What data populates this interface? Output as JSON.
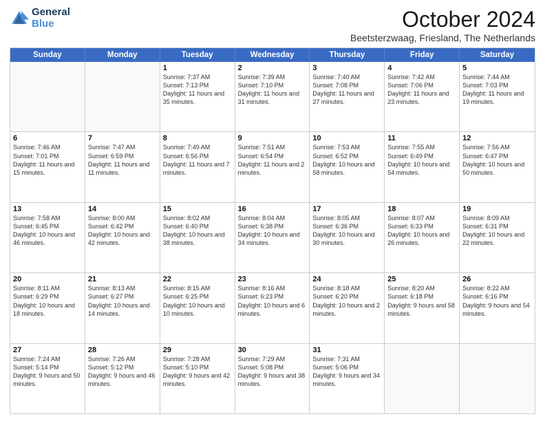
{
  "header": {
    "logo_line1": "General",
    "logo_line2": "Blue",
    "month": "October 2024",
    "location": "Beetsterzwaag, Friesland, The Netherlands"
  },
  "days_of_week": [
    "Sunday",
    "Monday",
    "Tuesday",
    "Wednesday",
    "Thursday",
    "Friday",
    "Saturday"
  ],
  "weeks": [
    [
      {
        "day": "",
        "sunrise": "",
        "sunset": "",
        "daylight": ""
      },
      {
        "day": "",
        "sunrise": "",
        "sunset": "",
        "daylight": ""
      },
      {
        "day": "1",
        "sunrise": "Sunrise: 7:37 AM",
        "sunset": "Sunset: 7:13 PM",
        "daylight": "Daylight: 11 hours and 35 minutes."
      },
      {
        "day": "2",
        "sunrise": "Sunrise: 7:39 AM",
        "sunset": "Sunset: 7:10 PM",
        "daylight": "Daylight: 11 hours and 31 minutes."
      },
      {
        "day": "3",
        "sunrise": "Sunrise: 7:40 AM",
        "sunset": "Sunset: 7:08 PM",
        "daylight": "Daylight: 11 hours and 27 minutes."
      },
      {
        "day": "4",
        "sunrise": "Sunrise: 7:42 AM",
        "sunset": "Sunset: 7:06 PM",
        "daylight": "Daylight: 11 hours and 23 minutes."
      },
      {
        "day": "5",
        "sunrise": "Sunrise: 7:44 AM",
        "sunset": "Sunset: 7:03 PM",
        "daylight": "Daylight: 11 hours and 19 minutes."
      }
    ],
    [
      {
        "day": "6",
        "sunrise": "Sunrise: 7:46 AM",
        "sunset": "Sunset: 7:01 PM",
        "daylight": "Daylight: 11 hours and 15 minutes."
      },
      {
        "day": "7",
        "sunrise": "Sunrise: 7:47 AM",
        "sunset": "Sunset: 6:59 PM",
        "daylight": "Daylight: 11 hours and 11 minutes."
      },
      {
        "day": "8",
        "sunrise": "Sunrise: 7:49 AM",
        "sunset": "Sunset: 6:56 PM",
        "daylight": "Daylight: 11 hours and 7 minutes."
      },
      {
        "day": "9",
        "sunrise": "Sunrise: 7:51 AM",
        "sunset": "Sunset: 6:54 PM",
        "daylight": "Daylight: 11 hours and 2 minutes."
      },
      {
        "day": "10",
        "sunrise": "Sunrise: 7:53 AM",
        "sunset": "Sunset: 6:52 PM",
        "daylight": "Daylight: 10 hours and 58 minutes."
      },
      {
        "day": "11",
        "sunrise": "Sunrise: 7:55 AM",
        "sunset": "Sunset: 6:49 PM",
        "daylight": "Daylight: 10 hours and 54 minutes."
      },
      {
        "day": "12",
        "sunrise": "Sunrise: 7:56 AM",
        "sunset": "Sunset: 6:47 PM",
        "daylight": "Daylight: 10 hours and 50 minutes."
      }
    ],
    [
      {
        "day": "13",
        "sunrise": "Sunrise: 7:58 AM",
        "sunset": "Sunset: 6:45 PM",
        "daylight": "Daylight: 10 hours and 46 minutes."
      },
      {
        "day": "14",
        "sunrise": "Sunrise: 8:00 AM",
        "sunset": "Sunset: 6:42 PM",
        "daylight": "Daylight: 10 hours and 42 minutes."
      },
      {
        "day": "15",
        "sunrise": "Sunrise: 8:02 AM",
        "sunset": "Sunset: 6:40 PM",
        "daylight": "Daylight: 10 hours and 38 minutes."
      },
      {
        "day": "16",
        "sunrise": "Sunrise: 8:04 AM",
        "sunset": "Sunset: 6:38 PM",
        "daylight": "Daylight: 10 hours and 34 minutes."
      },
      {
        "day": "17",
        "sunrise": "Sunrise: 8:05 AM",
        "sunset": "Sunset: 6:36 PM",
        "daylight": "Daylight: 10 hours and 30 minutes."
      },
      {
        "day": "18",
        "sunrise": "Sunrise: 8:07 AM",
        "sunset": "Sunset: 6:33 PM",
        "daylight": "Daylight: 10 hours and 26 minutes."
      },
      {
        "day": "19",
        "sunrise": "Sunrise: 8:09 AM",
        "sunset": "Sunset: 6:31 PM",
        "daylight": "Daylight: 10 hours and 22 minutes."
      }
    ],
    [
      {
        "day": "20",
        "sunrise": "Sunrise: 8:11 AM",
        "sunset": "Sunset: 6:29 PM",
        "daylight": "Daylight: 10 hours and 18 minutes."
      },
      {
        "day": "21",
        "sunrise": "Sunrise: 8:13 AM",
        "sunset": "Sunset: 6:27 PM",
        "daylight": "Daylight: 10 hours and 14 minutes."
      },
      {
        "day": "22",
        "sunrise": "Sunrise: 8:15 AM",
        "sunset": "Sunset: 6:25 PM",
        "daylight": "Daylight: 10 hours and 10 minutes."
      },
      {
        "day": "23",
        "sunrise": "Sunrise: 8:16 AM",
        "sunset": "Sunset: 6:23 PM",
        "daylight": "Daylight: 10 hours and 6 minutes."
      },
      {
        "day": "24",
        "sunrise": "Sunrise: 8:18 AM",
        "sunset": "Sunset: 6:20 PM",
        "daylight": "Daylight: 10 hours and 2 minutes."
      },
      {
        "day": "25",
        "sunrise": "Sunrise: 8:20 AM",
        "sunset": "Sunset: 6:18 PM",
        "daylight": "Daylight: 9 hours and 58 minutes."
      },
      {
        "day": "26",
        "sunrise": "Sunrise: 8:22 AM",
        "sunset": "Sunset: 6:16 PM",
        "daylight": "Daylight: 9 hours and 54 minutes."
      }
    ],
    [
      {
        "day": "27",
        "sunrise": "Sunrise: 7:24 AM",
        "sunset": "Sunset: 5:14 PM",
        "daylight": "Daylight: 9 hours and 50 minutes."
      },
      {
        "day": "28",
        "sunrise": "Sunrise: 7:26 AM",
        "sunset": "Sunset: 5:12 PM",
        "daylight": "Daylight: 9 hours and 46 minutes."
      },
      {
        "day": "29",
        "sunrise": "Sunrise: 7:28 AM",
        "sunset": "Sunset: 5:10 PM",
        "daylight": "Daylight: 9 hours and 42 minutes."
      },
      {
        "day": "30",
        "sunrise": "Sunrise: 7:29 AM",
        "sunset": "Sunset: 5:08 PM",
        "daylight": "Daylight: 9 hours and 38 minutes."
      },
      {
        "day": "31",
        "sunrise": "Sunrise: 7:31 AM",
        "sunset": "Sunset: 5:06 PM",
        "daylight": "Daylight: 9 hours and 34 minutes."
      },
      {
        "day": "",
        "sunrise": "",
        "sunset": "",
        "daylight": ""
      },
      {
        "day": "",
        "sunrise": "",
        "sunset": "",
        "daylight": ""
      }
    ]
  ]
}
